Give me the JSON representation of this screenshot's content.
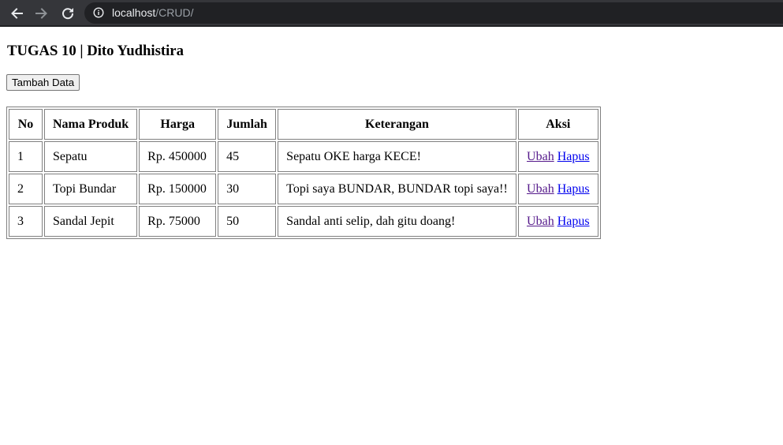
{
  "browser": {
    "url_host": "localhost",
    "url_path": "/CRUD/",
    "icons": {
      "back": "arrow-left-icon",
      "forward": "arrow-right-icon",
      "reload": "reload-icon",
      "info": "info-icon"
    }
  },
  "page": {
    "title": "TUGAS 10 | Dito Yudhistira",
    "add_button_label": "Tambah Data"
  },
  "table": {
    "headers": [
      "No",
      "Nama Produk",
      "Harga",
      "Jumlah",
      "Keterangan",
      "Aksi"
    ],
    "rows": [
      {
        "no": "1",
        "nama": "Sepatu",
        "harga": "Rp. 450000",
        "jumlah": "45",
        "keterangan": "Sepatu OKE harga KECE!",
        "ubah": "Ubah",
        "hapus": "Hapus"
      },
      {
        "no": "2",
        "nama": "Topi Bundar",
        "harga": "Rp. 150000",
        "jumlah": "30",
        "keterangan": "Topi saya BUNDAR, BUNDAR topi saya!!",
        "ubah": "Ubah",
        "hapus": "Hapus"
      },
      {
        "no": "3",
        "nama": "Sandal Jepit",
        "harga": "Rp. 75000",
        "jumlah": "50",
        "keterangan": "Sandal anti selip, dah gitu doang!",
        "ubah": "Ubah",
        "hapus": "Hapus"
      }
    ]
  },
  "colors": {
    "link": "#0000ee",
    "visited_link": "#551a8b",
    "browser_bar": "#35363a",
    "address_bar": "#202124"
  }
}
